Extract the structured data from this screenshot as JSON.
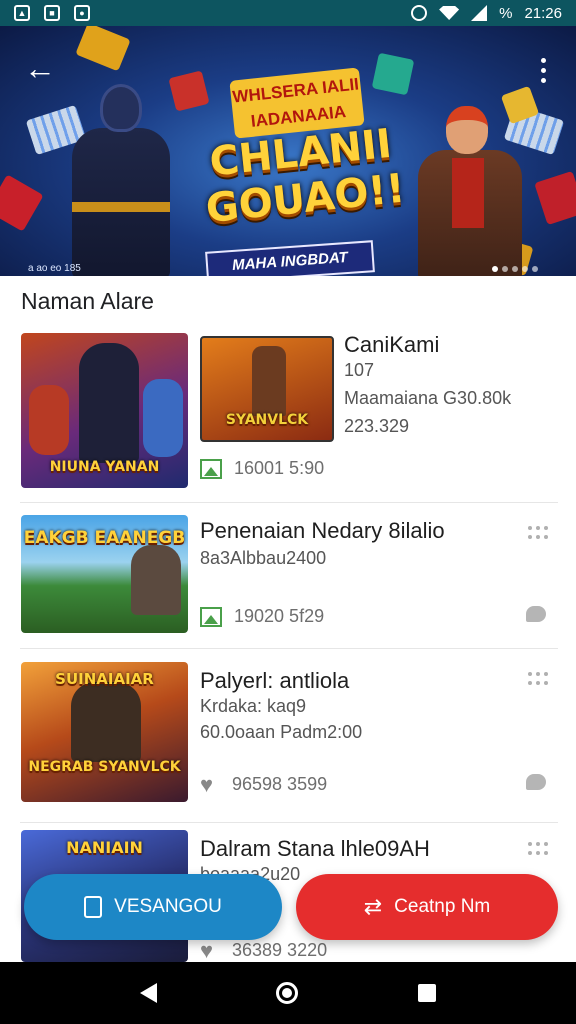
{
  "status_bar": {
    "time": "21:26",
    "battery_label": "%"
  },
  "banner": {
    "sub_title": "WHLSERA IALII IADANAAIA",
    "main_title": "CHLANII GOUAO!!",
    "tag": "MAHA INGBDAT",
    "small_text": "a ao eo 185"
  },
  "section": {
    "title": "Naman Alare"
  },
  "items": [
    {
      "thumb_caption": "NIUNA YANAN",
      "thumb2_caption": "SYANVLCK",
      "title": "CaniKami",
      "line1": "107",
      "line2": "Maamaiana G30.80k",
      "line3": "223.329",
      "meta": "16001 5:90"
    },
    {
      "thumb_caption": "EAKGB EAANEGB",
      "title": "Penenaian Nedary 8ilalio",
      "line1": "8a3Albbau2400",
      "meta": "19020 5f29"
    },
    {
      "thumb_caption": "SUINAIAIAR",
      "thumb_caption2": "NEGRAB SYANVLCK",
      "title": "Palyerl: antliola",
      "line1": "Krdaka: kaq9",
      "line2": "60.0oaan Padm2:00",
      "meta": "96598 3599"
    },
    {
      "thumb_caption": "NANIAIN",
      "title": "Dalram Stana lhle09AH",
      "line1": "boaaaa2u20",
      "meta": "36389 3220"
    }
  ],
  "actions": {
    "left_label": "VESANGOU",
    "right_label": "Ceatnp Nm"
  },
  "colors": {
    "blue": "#1d87c6",
    "red": "#e52d2d",
    "status_bar": "#0d5560"
  }
}
